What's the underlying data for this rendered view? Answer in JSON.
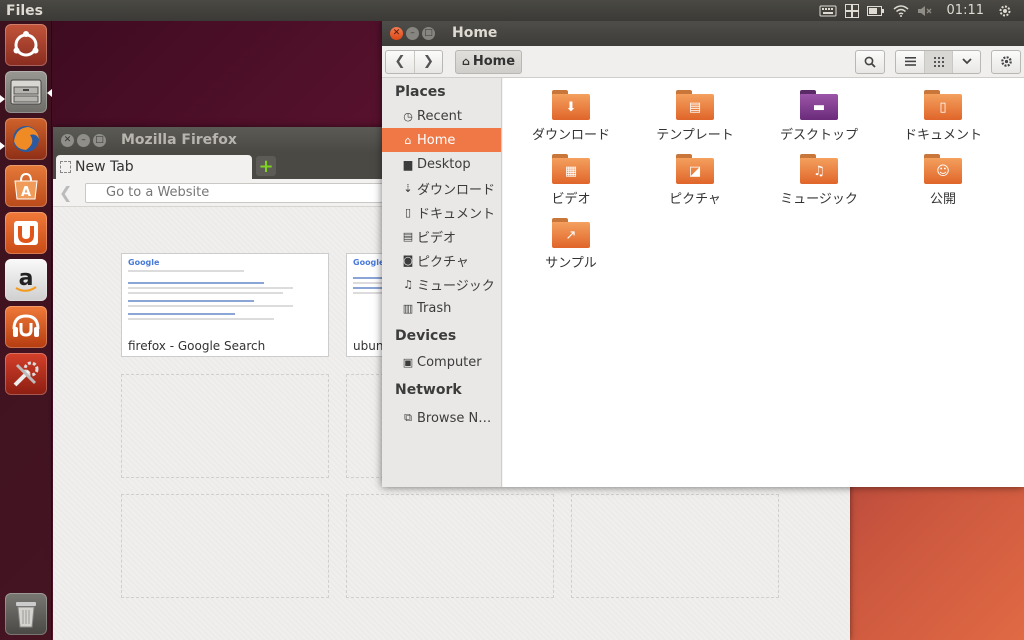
{
  "top_panel": {
    "title": "Files",
    "clock": "01:11",
    "indicators": [
      "keyboard-icon",
      "workspaces-icon",
      "battery-icon",
      "wifi-icon",
      "sound-icon"
    ]
  },
  "launcher": {
    "items": [
      "dash-home",
      "files",
      "firefox",
      "software-center",
      "ubuntu-one",
      "amazon",
      "ubuntu-one-music",
      "system-settings",
      "trash"
    ]
  },
  "firefox": {
    "title": "Mozilla Firefox",
    "tab_label": "New Tab",
    "url_placeholder": "Go to a Website",
    "thumbnails": [
      {
        "label": "firefox - Google Search",
        "logo": "Google"
      },
      {
        "label": "ubuntu",
        "logo": "Google"
      }
    ]
  },
  "files": {
    "title": "Home",
    "path_label": "Home",
    "sidebar": {
      "places_header": "Places",
      "places": [
        {
          "label": "Recent",
          "icon": "clock-icon"
        },
        {
          "label": "Home",
          "icon": "home-icon"
        },
        {
          "label": "Desktop",
          "icon": "desktop-icon"
        },
        {
          "label": "ダウンロード",
          "icon": "download-icon"
        },
        {
          "label": "ドキュメント",
          "icon": "document-icon"
        },
        {
          "label": "ビデオ",
          "icon": "film-icon"
        },
        {
          "label": "ピクチャ",
          "icon": "camera-icon"
        },
        {
          "label": "ミュージック",
          "icon": "music-icon"
        },
        {
          "label": "Trash",
          "icon": "trash-icon"
        }
      ],
      "devices_header": "Devices",
      "devices": [
        {
          "label": "Computer",
          "icon": "computer-icon"
        }
      ],
      "network_header": "Network",
      "network": [
        {
          "label": "Browse N…",
          "icon": "network-icon"
        }
      ]
    },
    "folders": [
      {
        "name": "ダウンロード",
        "icon": "download-icon"
      },
      {
        "name": "テンプレート",
        "icon": "template-icon"
      },
      {
        "name": "デスクトップ",
        "icon": "desktop-icon"
      },
      {
        "name": "ドキュメント",
        "icon": "document-icon"
      },
      {
        "name": "ビデオ",
        "icon": "film-icon"
      },
      {
        "name": "ピクチャ",
        "icon": "picture-icon"
      },
      {
        "name": "ミュージック",
        "icon": "music-icon"
      },
      {
        "name": "公開",
        "icon": "user-icon"
      },
      {
        "name": "サンプル",
        "icon": "link-icon"
      }
    ]
  }
}
